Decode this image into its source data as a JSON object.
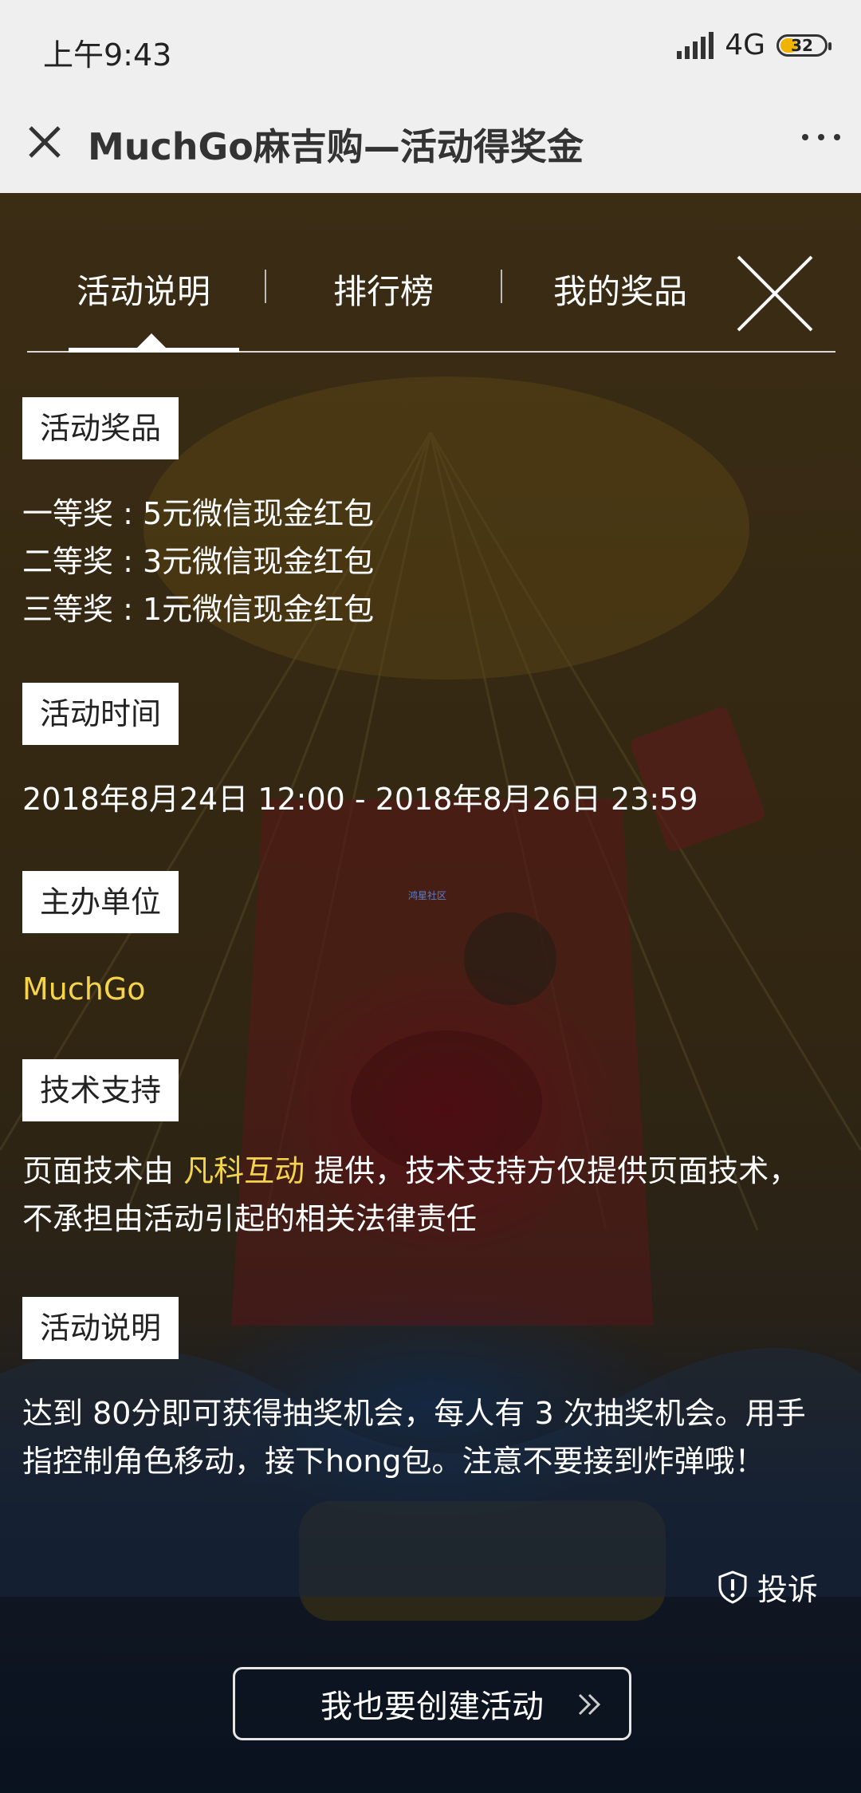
{
  "status_bar": {
    "time": "上午9:43",
    "network": "4G",
    "battery": "32"
  },
  "nav": {
    "title": "MuchGo麻吉购—活动得奖金"
  },
  "tabs": [
    {
      "label": "活动说明"
    },
    {
      "label": "排行榜"
    },
    {
      "label": "我的奖品"
    }
  ],
  "sections": {
    "prizes": {
      "label": "活动奖品",
      "lines": [
        "一等奖 : 5元微信现金红包",
        "二等奖 : 3元微信现金红包",
        "三等奖 : 1元微信现金红包"
      ]
    },
    "time": {
      "label": "活动时间",
      "value": "2018年8月24日 12:00 - 2018年8月26日 23:59"
    },
    "organizer": {
      "label": "主办单位",
      "value": "MuchGo"
    },
    "tech": {
      "label": "技术支持",
      "prefix": "页面技术由 ",
      "provider": "凡科互动",
      "suffix": " 提供，技术支持方仅提供页面技术，不承担由活动引起的相关法律责任"
    },
    "desc": {
      "label": "活动说明",
      "text": "达到 80分即可获得抽奖机会，每人有 3 次抽奖机会。用手指控制角色移动，接下hong包。注意不要接到炸弹哦！"
    }
  },
  "watermark": "鸿星社区",
  "complain": {
    "label": "投诉"
  },
  "create_button": {
    "label": "我也要创建活动"
  },
  "colors": {
    "highlight": "#f6d44a",
    "tab_active": "#ffffff"
  }
}
